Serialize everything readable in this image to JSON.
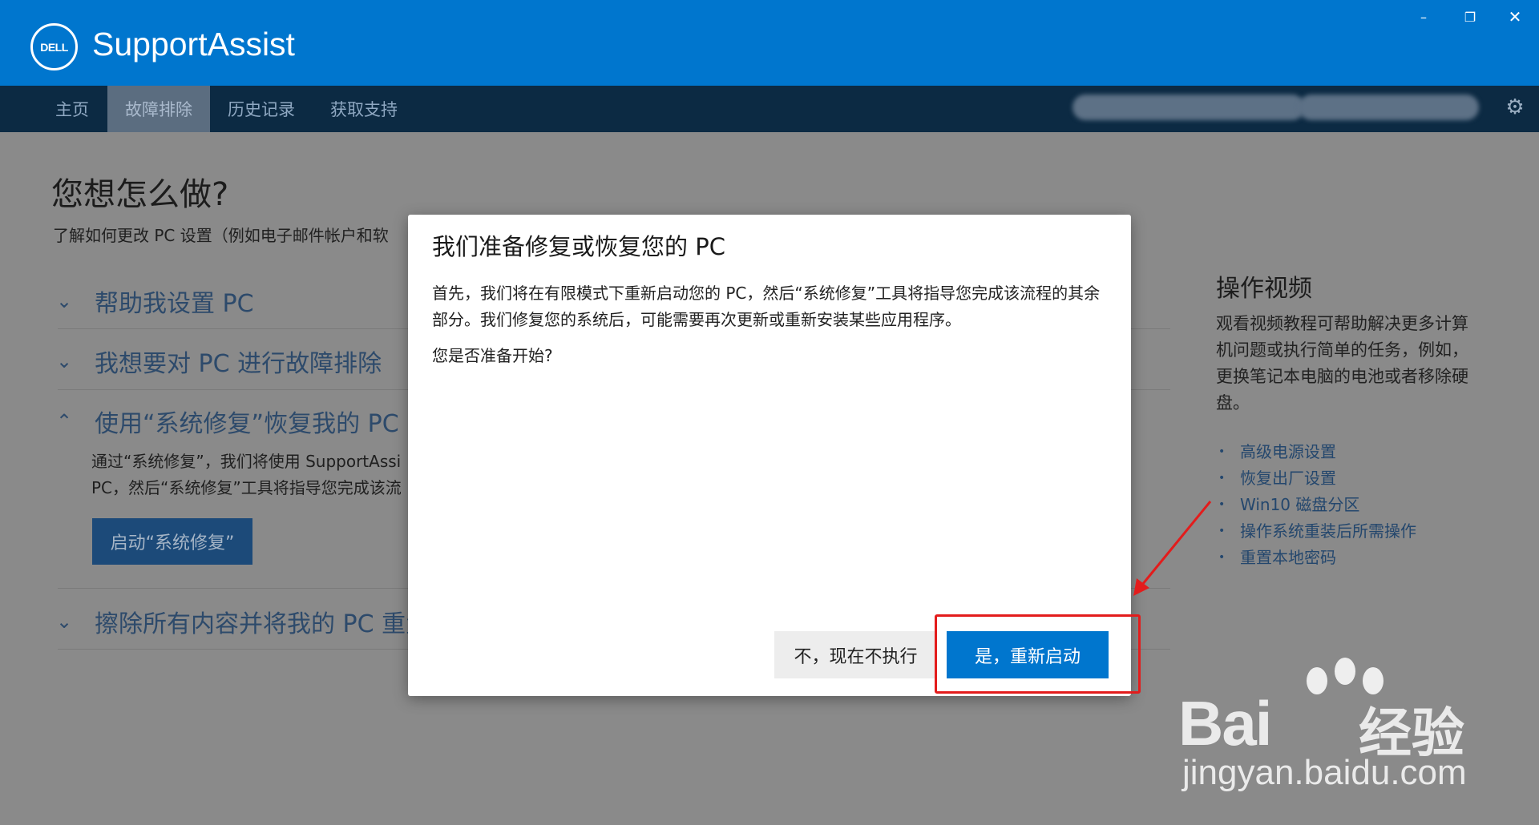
{
  "app": {
    "title": "SupportAssist",
    "logo_text": "DELL"
  },
  "window_controls": {
    "minimize": "–",
    "maximize": "❐",
    "close": "✕"
  },
  "nav": {
    "tabs": [
      {
        "label": "主页"
      },
      {
        "label": "故障排除",
        "active": true
      },
      {
        "label": "历史记录"
      },
      {
        "label": "获取支持"
      }
    ],
    "settings_icon": "⚙"
  },
  "main": {
    "title": "您想怎么做?",
    "subtitle": "了解如何更改 PC 设置（例如电子邮件帐户和软",
    "accordion": [
      {
        "label": "帮助我设置 PC",
        "expanded": false
      },
      {
        "label": "我想要对 PC 进行故障排除",
        "expanded": false
      },
      {
        "label": "使用“系统修复”恢复我的 PC",
        "expanded": true,
        "body_lines": [
          "通过“系统修复”，我们将使用 SupportAssi",
          "PC，然后“系统修复”工具将指导您完成该流"
        ],
        "button": "启动“系统修复”"
      },
      {
        "label": "擦除所有内容并将我的 PC 重置",
        "expanded": false
      }
    ]
  },
  "sidebar": {
    "title": "操作视频",
    "description": "观看视频教程可帮助解决更多计算机问题或执行简单的任务，例如，更换笔记本电脑的电池或者移除硬盘。",
    "links": [
      "高级电源设置",
      "恢复出厂设置",
      "Win10 磁盘分区",
      "操作系统重装后所需操作",
      "重置本地密码"
    ]
  },
  "dialog": {
    "title": "我们准备修复或恢复您的 PC",
    "body": "首先，我们将在有限模式下重新启动您的 PC，然后“系统修复”工具将指导您完成该流程的其余部分。我们修复您的系统后，可能需要再次更新或重新安装某些应用程序。",
    "question": "您是否准备开始?",
    "cancel_label": "不，现在不执行",
    "confirm_label": "是，重新启动"
  },
  "watermark": {
    "brand": "Bai",
    "brand_cn": "经验",
    "url": "jingyan.baidu.com"
  },
  "colors": {
    "dell_blue": "#0076ce",
    "nav_dark": "#174f7d",
    "annotation_red": "#e31c1c"
  }
}
